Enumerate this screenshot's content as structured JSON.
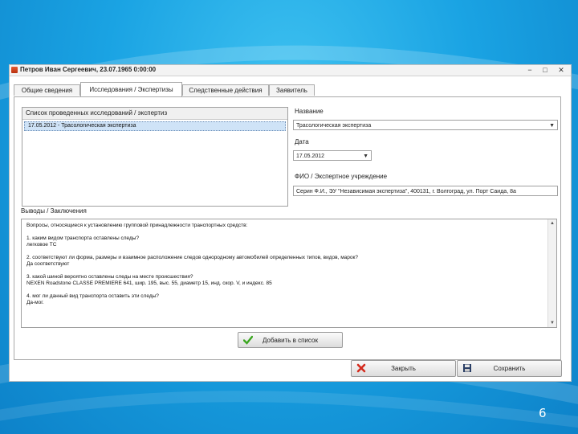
{
  "window": {
    "title": "Петров Иван Сергеевич, 23.07.1965 0:00:00",
    "minimize": "−",
    "maximize": "□",
    "close": "✕"
  },
  "tabs": [
    {
      "label": "Общие сведения",
      "active": false
    },
    {
      "label": "Исследования / Экспертизы",
      "active": true
    },
    {
      "label": "Следственные действия",
      "active": false
    },
    {
      "label": "Заявитель",
      "active": false
    }
  ],
  "research_list": {
    "header": "Список проведенных исследований / экспертиз",
    "items": [
      "17.05.2012 - Трасологическая экспертиза"
    ]
  },
  "name_field": {
    "label": "Название",
    "value": "Трасологическая экспертиза"
  },
  "date_field": {
    "label": "Дата",
    "value": "17.05.2012"
  },
  "expert_field": {
    "label": "ФИО / Экспертное учреждение",
    "value": "Серин Ф.И., ЭУ \"Независимая экспертиза\", 400131, г. Волгоград, ул. Порт Саида, 8а"
  },
  "conclusions": {
    "label": "Выводы / Заключения",
    "text": "Вопросы, относящиеся к установлению групповой принадлежности транспортных средств:\n\n1. каким видом транспорта оставлены следы?\nлегковое ТС\n\n2. соответствуют ли форма, размеры и взаимное расположение следов однородному автомобилей определенных типов, видов, марок?\nДа соответствуют\n\n3. какой шиной вероятно оставлены следы на месте происшествия?\nNEXEN Roadstone CLASSE PREMIERE 641, шир. 195, выс. 55, диаметр 15, инд. скор. V, и индекс. 85\n\n4. мог ли данный вид транспорта оставить эти следы?\nДа-мог."
  },
  "buttons": {
    "add": "Добавить в список",
    "close": "Закрыть",
    "save": "Сохранить"
  },
  "slide": {
    "page_number": "6"
  },
  "colors": {
    "accent_check": "#3aa61f",
    "close_red": "#d42b1e",
    "slide_blue": "#1aa3e3"
  }
}
